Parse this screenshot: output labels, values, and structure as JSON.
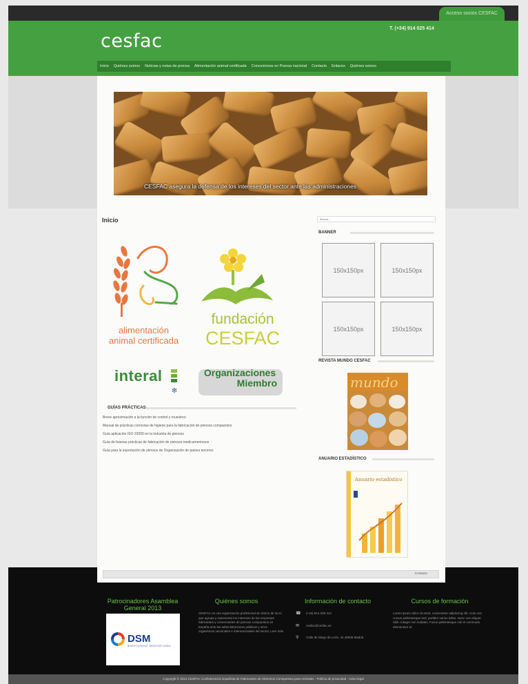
{
  "header": {
    "access_tab": "Acceso socios CESFAC",
    "brand": "cesfac",
    "phone": "T. (+34) 914 025 414",
    "nav": [
      "Inicio",
      "Quiénes somos",
      "Noticias y notas de prensa",
      "Alimentación animal certificada",
      "Concesiones en Prensa nacional",
      "Contacto",
      "Enlaces",
      "Quiénes somos"
    ]
  },
  "hero": {
    "caption": "CESFAC asegura la defensa de los intereses del sector ante las administraciones"
  },
  "main": {
    "page_title": "Inicio",
    "logo_aac_line1": "alimentación",
    "logo_aac_line2": "animal certificada",
    "logo_fund_line1": "fundación",
    "logo_fund_line2": "CESFAC",
    "logo_interal": "interal",
    "logo_org_line1": "Organizaciones",
    "logo_org_line2": "Miembro",
    "guides_title": "GUÍAS PRÁCTICAS",
    "guides": [
      "Breve aproximación a la función de control y muestreo",
      "Manual de prácticas correctas de higiene para la fabricación de piensos compuestos",
      "Guía aplicación ISO 22000 en la industria de piensos",
      "Guía de buenas prácticas de fabricación de piensos medicamentosos",
      "Guía para la exportación de piensos de Organización de países terceros"
    ]
  },
  "sidebar": {
    "search_placeholder": "Buscar...",
    "banner_title": "BANNER",
    "ads": [
      "150x150px",
      "150x150px",
      "150x150px",
      "150x150px"
    ],
    "magazine_title": "REVISTA MUNDO CESFAC",
    "magazine_cover_word": "mundo",
    "stats_title": "ANUARIO ESTADÍSTICO",
    "stats_cover_text": "Anuario estadístico"
  },
  "footbar": {
    "contact": "Contacto"
  },
  "footer": {
    "col1_title": "Patrocinadores Asamblea General 2013",
    "sponsor_logo": "DSM",
    "sponsor_sub": "BRIGHT SCIENCE. BRIGHTER LIVING.",
    "col2_title": "Quiénes somos",
    "col2_text": "CESFAC es una organización profesional sin ánimo de lucro que agrupa y representa los intereses de las empresas fabricantes y comerciantes de piensos compuestos en España ante las administraciones públicas y otros organismos nacionales e internacionales del sector. Leer más",
    "col3_title": "Información de contacto",
    "col3_items": [
      {
        "icon": "phone-icon",
        "glyph": "☎",
        "text": "(+34) 914 025 414"
      },
      {
        "icon": "mail-icon",
        "glyph": "✉",
        "text": "cesfac@cesfac.es"
      },
      {
        "icon": "location-icon",
        "glyph": "⚲",
        "text": "Calle de Diego de León, 44 28006 Madrid"
      }
    ],
    "col4_title": "Cursos de formación",
    "col4_text": "Lorem ipsum dolor sit amet, consectetur adipiscing elit. Cras non cursus pellentesque sed, porttitor varius tellus. Nunc non aliquet nibh. Integer non sodales. Fusce pellentesque nisi et commodo elementum id."
  },
  "copyright": "Copyright © 2013 CESFAC Confederación Española de Fabricantes de Alimentos Compuestos para Animales · Política de privacidad · Aviso legal"
}
